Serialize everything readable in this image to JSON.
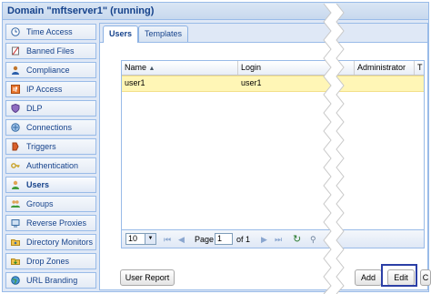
{
  "window": {
    "title": "Domain \"mftserver1\" (running)"
  },
  "sidebar": {
    "items": [
      {
        "label": "Time Access",
        "icon": "clock-icon"
      },
      {
        "label": "Banned Files",
        "icon": "banned-file-icon"
      },
      {
        "label": "Compliance",
        "icon": "person-icon"
      },
      {
        "label": "IP Access",
        "icon": "ip-icon"
      },
      {
        "label": "DLP",
        "icon": "shield-icon"
      },
      {
        "label": "Connections",
        "icon": "connections-icon"
      },
      {
        "label": "Triggers",
        "icon": "trigger-icon"
      },
      {
        "label": "Authentication",
        "icon": "key-icon"
      },
      {
        "label": "Users",
        "icon": "user-icon",
        "selected": true
      },
      {
        "label": "Groups",
        "icon": "group-icon"
      },
      {
        "label": "Reverse Proxies",
        "icon": "proxy-icon"
      },
      {
        "label": "Directory Monitors",
        "icon": "directory-monitor-icon"
      },
      {
        "label": "Drop Zones",
        "icon": "drop-zone-icon"
      },
      {
        "label": "URL Branding",
        "icon": "globe-icon"
      }
    ]
  },
  "tabs": [
    {
      "label": "Users",
      "active": true
    },
    {
      "label": "Templates",
      "active": false
    }
  ],
  "grid": {
    "columns": [
      "Name",
      "Login",
      "Administrator",
      "T"
    ],
    "rows": [
      {
        "name": "user1",
        "login": "user1"
      }
    ]
  },
  "pager": {
    "page_size": "10",
    "page_label": "Page",
    "page_value": "1",
    "of_label": "of 1"
  },
  "buttons": {
    "user_report": "User Report",
    "add": "Add",
    "edit": "Edit",
    "partial": "C"
  }
}
